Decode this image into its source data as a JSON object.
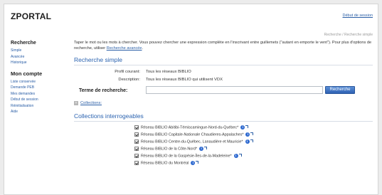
{
  "header": {
    "logo": "ZPORTAL",
    "logout_label": "Début de session"
  },
  "breadcrumb": "Recherche / Recherche simple",
  "sidebar": {
    "groups": [
      {
        "title": "Recherche",
        "items": [
          "Simple",
          "Avancée",
          "Historique"
        ]
      },
      {
        "title": "Mon compte",
        "items": [
          "Liste conservée",
          "Demande PEB",
          "Mes demandes",
          "Début de session",
          "Réinitialisation",
          "Aide"
        ]
      }
    ]
  },
  "main": {
    "intro": "Taper le mot ou les mots à chercher. Vous pouvez chercher une expression complète en l'inscrivant entre guillemets (\"autant en emporte le vent\"). Pour plus d'options de recherche, utiliser",
    "intro_link": "Recherche avancée",
    "intro_end": ".",
    "simple_title": "Recherche simple",
    "profile_label": "Profil courant:",
    "profile_value": "Tous les réseaux BIBLIO",
    "description_label": "Description:",
    "description_value": "Tous les réseaux BIBLIO qui utilisent VDX",
    "term_label": "Terme de recherche:",
    "term_value": "",
    "search_button": "Recherche",
    "collections_toggle_symbol": "+",
    "collections_link": "Collections:",
    "collections_title": "Collections interrogeables",
    "collections": [
      "Réseau BIBLIO Abitibi-Témiscamingue-Nord-du-Québec*",
      "Réseau BIBLIO Capitale-Nationale Chaudieres-Appalaches*",
      "Réseau BIBLIO Centre-du-Québec, Lanaudière et Mauricie*",
      "Réseau BIBLIO de la Côte-Nord*",
      "Réseau BIBLIO de la Gaspésie-Îles-de-la-Madeleine*",
      "Réseau BIBLIO du Montréal"
    ]
  },
  "colors": {
    "accent": "#2b63b0",
    "link": "#2a5ea6",
    "button": "#2f62b3"
  }
}
